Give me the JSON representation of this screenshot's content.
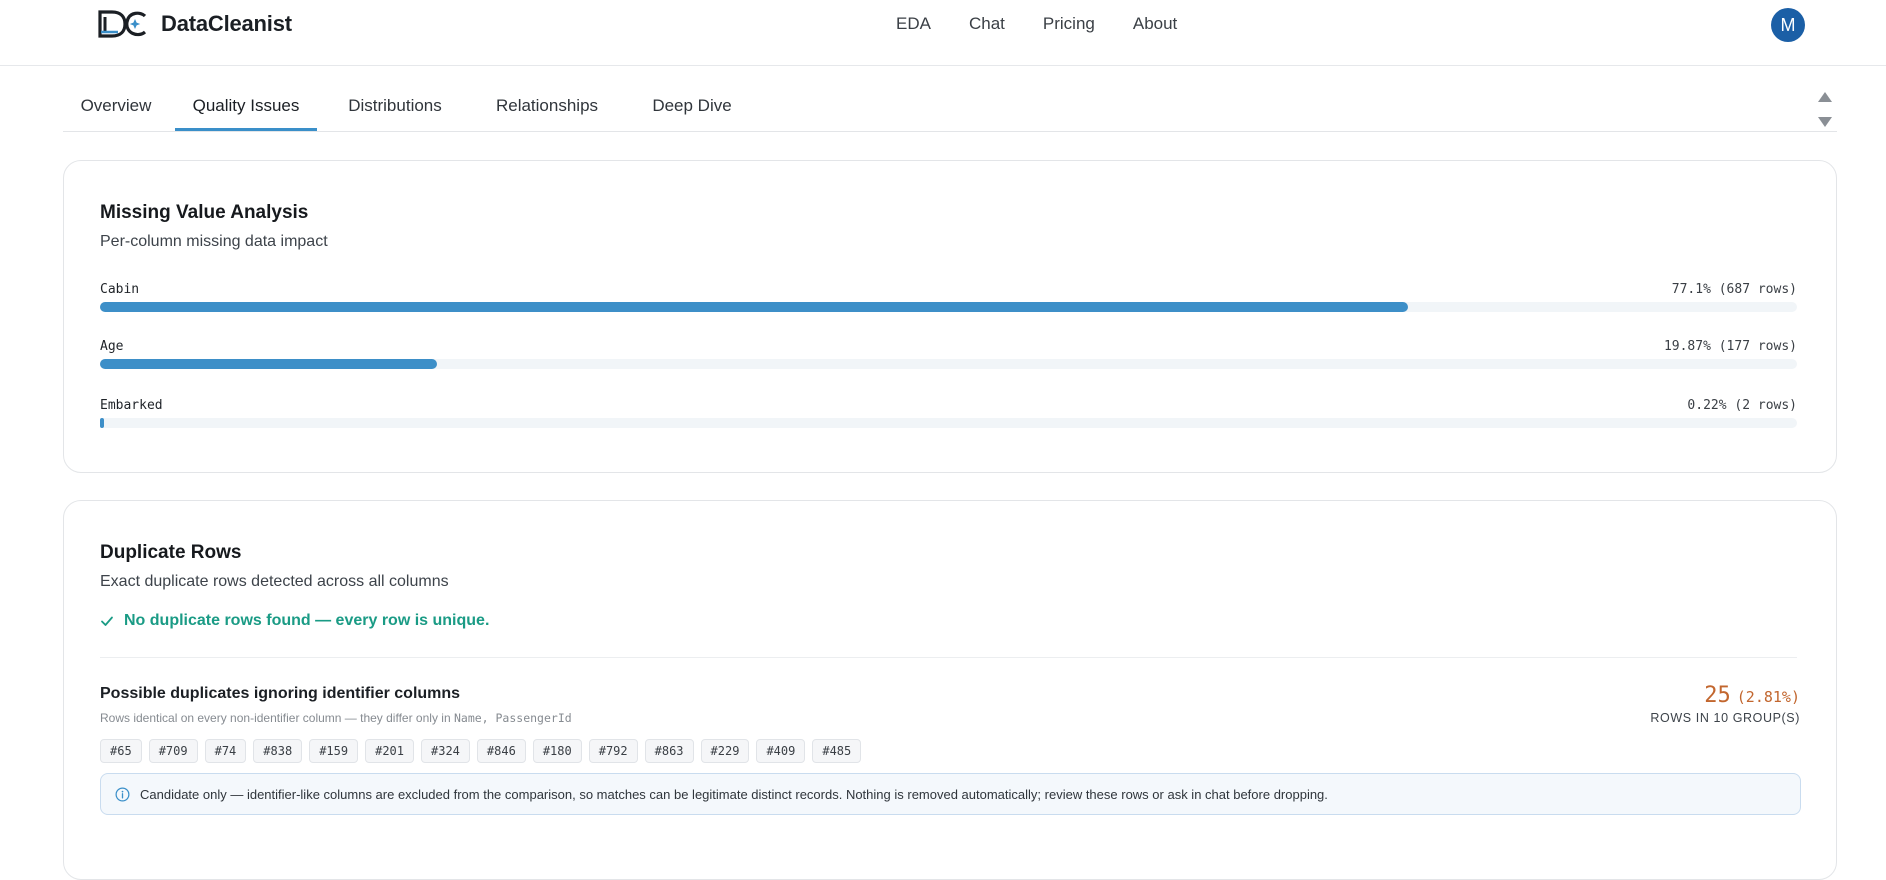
{
  "app": {
    "name": "DataCleanist",
    "nav": [
      "EDA",
      "Chat",
      "Pricing",
      "About"
    ],
    "avatar_initial": "M",
    "accent": "#3d8fc8",
    "avatar_color": "#1b5fa6"
  },
  "tabs": [
    {
      "label": "Overview",
      "active": false
    },
    {
      "label": "Quality Issues",
      "active": true
    },
    {
      "label": "Distributions",
      "active": false
    },
    {
      "label": "Relationships",
      "active": false
    },
    {
      "label": "Deep Dive",
      "active": false
    }
  ],
  "missing": {
    "title": "Missing Value Analysis",
    "subtitle": "Per-column missing data impact",
    "rows": [
      {
        "column": "Cabin",
        "value": "77.1% (687 rows)",
        "fraction": 0.771
      },
      {
        "column": "Age",
        "value": "19.87% (177 rows)",
        "fraction": 0.1987
      },
      {
        "column": "Embarked",
        "value": "0.22% (2 rows)",
        "fraction": 0.0022
      }
    ]
  },
  "duplicates": {
    "title": "Duplicate Rows",
    "subtitle": "Exact duplicate rows detected across all columns",
    "status": "No duplicate rows found — every row is unique.",
    "status_color": "#1a9b85",
    "possible": {
      "title": "Possible duplicates ignoring identifier columns",
      "note_prefix": "Rows identical on every non-identifier column — they differ only in",
      "note_columns": "Name, PassengerId",
      "count": "25",
      "percent": "(2.81%)",
      "count_label": "ROWS IN 10 GROUP(S)",
      "count_color": "#c2662e",
      "rows": [
        "#65",
        "#709",
        "#74",
        "#838",
        "#159",
        "#201",
        "#324",
        "#846",
        "#180",
        "#792",
        "#863",
        "#229",
        "#409",
        "#485"
      ],
      "info": "Candidate only — identifier-like columns are excluded from the comparison, so matches can be legitimate distinct records. Nothing is removed automatically; review these rows or ask in chat before dropping."
    }
  }
}
